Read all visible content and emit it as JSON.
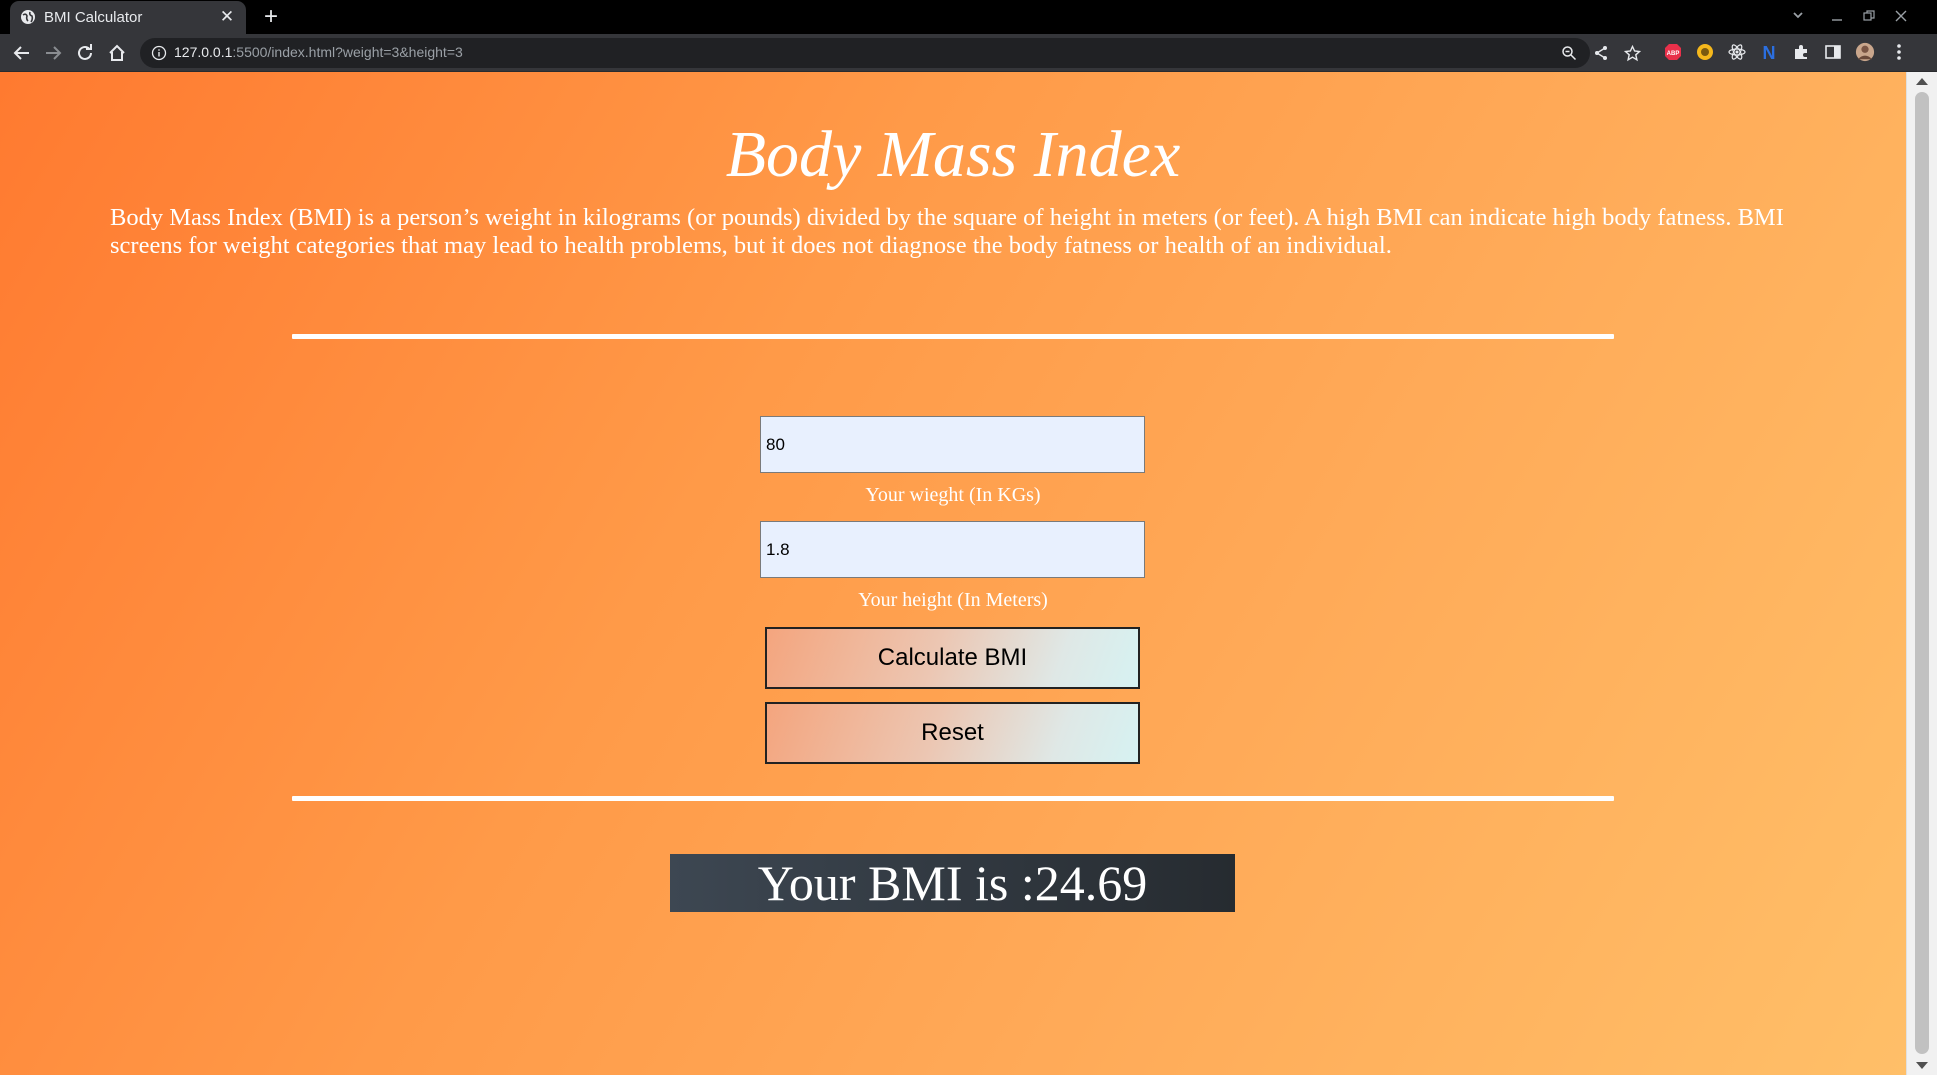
{
  "browser": {
    "tab": {
      "title": "BMI Calculator",
      "close": "✕"
    },
    "new_tab": "+",
    "url": {
      "host": "127.0.0.1",
      "rest": ":5500/index.html?weight=3&height=3"
    },
    "window_controls": {
      "dropdown": "⌄",
      "minimize": "—",
      "restore": "❐",
      "close": "✕"
    },
    "extensions": {
      "abp": "ABP",
      "n_ext": "N"
    }
  },
  "page": {
    "title": "Body Mass Index",
    "intro": "Body Mass Index (BMI) is a person’s weight in kilograms (or pounds) divided by the square of height in meters (or feet). A high BMI can indicate high body fatness. BMI screens for weight categories that may lead to health problems, but it does not diagnose the body fatness or health of an individual.",
    "weight_field": {
      "value": "80",
      "label": "Your wieght (In KGs)"
    },
    "height_field": {
      "value": "1.8",
      "label": "Your height (In Meters)"
    },
    "calculate_label": "Calculate BMI",
    "reset_label": "Reset",
    "result": "Your BMI is :24.69"
  },
  "colors": {
    "page_gradient_start": "#ff7a30",
    "page_gradient_end": "#ffbf68",
    "field_background": "#e8f0fe",
    "result_background": "#2f353b"
  }
}
